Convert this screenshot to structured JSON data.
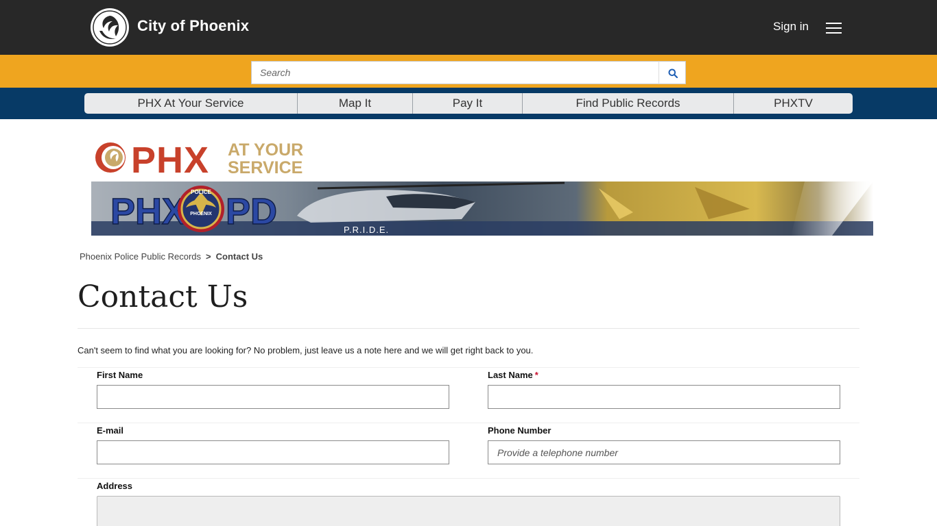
{
  "header": {
    "brand": "City of Phoenix",
    "sign_in": "Sign in"
  },
  "search": {
    "placeholder": "Search"
  },
  "nav": {
    "items": [
      "PHX At Your Service",
      "Map It",
      "Pay It",
      "Find Public Records",
      "PHXTV"
    ]
  },
  "banner": {
    "logo_word": "PHX",
    "logo_tagline_1": "AT YOUR",
    "logo_tagline_2": "SERVICE",
    "pd_left": "PHX",
    "pd_right": "PD",
    "badge_top": "POLICE",
    "badge_bottom": "PHOENIX",
    "motto": "P.R.I.D.E."
  },
  "breadcrumb": {
    "parent": "Phoenix Police Public Records",
    "separator": ">",
    "current": "Contact Us"
  },
  "page": {
    "title": "Contact Us",
    "intro": "Can't seem to find what you are looking for? No problem, just leave us a note here and we will get right back to you."
  },
  "form": {
    "first_name_label": "First Name",
    "last_name_label": "Last Name",
    "required_mark": "*",
    "email_label": "E-mail",
    "phone_label": "Phone Number",
    "phone_placeholder": "Provide a telephone number",
    "address_label": "Address"
  },
  "colors": {
    "header_bg": "#282828",
    "search_band": "#efa51f",
    "nav_band": "#073a66",
    "logo_red": "#c8412b",
    "logo_gold": "#c9a96a"
  }
}
